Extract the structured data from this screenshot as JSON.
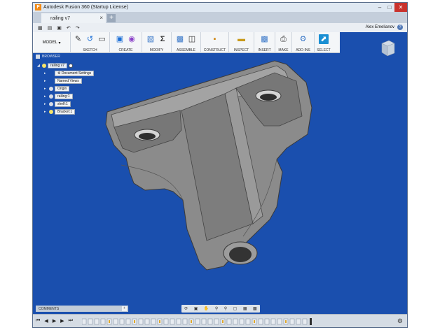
{
  "app": {
    "title": "Autodesk Fusion 360 (Startup License)",
    "user": "Alex Emelianov"
  },
  "tab": {
    "label": "railing v7"
  },
  "workspace": {
    "label": "MODEL"
  },
  "toolbar": {
    "groups": [
      {
        "label": "SKETCH"
      },
      {
        "label": "CREATE"
      },
      {
        "label": "MODIFY"
      },
      {
        "label": "ASSEMBLE"
      },
      {
        "label": "CONSTRUCT"
      },
      {
        "label": "INSPECT"
      },
      {
        "label": "INSERT"
      },
      {
        "label": "MAKE"
      },
      {
        "label": "ADD-INS"
      },
      {
        "label": "SELECT"
      }
    ]
  },
  "browser": {
    "header": "BROWSER",
    "root": "railing v7",
    "items": [
      {
        "label": "Document Settings"
      },
      {
        "label": "Named Views"
      },
      {
        "label": "Origin"
      },
      {
        "label": "railing:1"
      },
      {
        "label": "shelf:1"
      },
      {
        "label": "Bracket:1"
      }
    ]
  },
  "comments": {
    "label": "COMMENTS"
  },
  "colors": {
    "viewport": "#1a4fae",
    "accent": "#1a8fd3",
    "part": "#8c8c8c"
  }
}
